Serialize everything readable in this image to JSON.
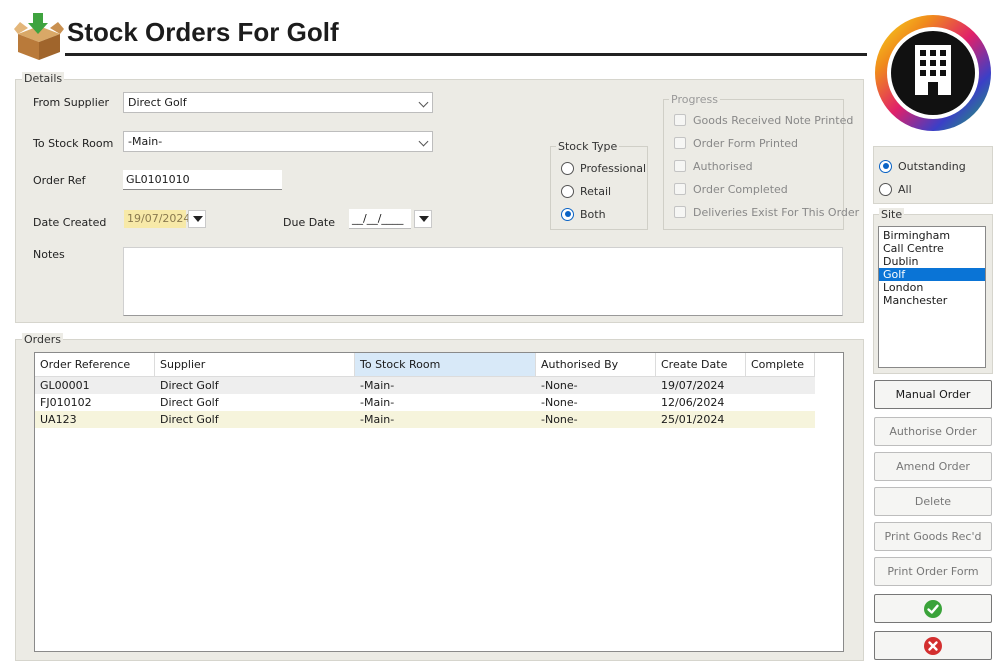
{
  "header": {
    "title": "Stock Orders For Golf",
    "logo_icon": "building-icon",
    "title_icon": "box-arrow-icon"
  },
  "details": {
    "legend": "Details",
    "from_supplier_label": "From Supplier",
    "from_supplier_value": "Direct Golf",
    "to_stock_room_label": "To Stock Room",
    "to_stock_room_value": "-Main-",
    "order_ref_label": "Order Ref",
    "order_ref_value": "GL0101010",
    "date_created_label": "Date Created",
    "date_created_value": "19/07/2024",
    "due_date_label": "Due Date",
    "due_date_value": "__/__/____",
    "notes_label": "Notes",
    "notes_value": ""
  },
  "stock_type": {
    "legend": "Stock Type",
    "options": [
      {
        "label": "Professional",
        "selected": false
      },
      {
        "label": "Retail",
        "selected": false
      },
      {
        "label": "Both",
        "selected": true
      }
    ]
  },
  "progress": {
    "legend": "Progress",
    "items": [
      {
        "label": "Goods Received Note Printed",
        "checked": false
      },
      {
        "label": "Order Form Printed",
        "checked": false
      },
      {
        "label": "Authorised",
        "checked": false
      },
      {
        "label": "Order Completed",
        "checked": false
      },
      {
        "label": "Deliveries Exist For This Order",
        "checked": false
      }
    ]
  },
  "orders": {
    "legend": "Orders",
    "columns": [
      "Order Reference",
      "Supplier",
      "To Stock Room",
      "Authorised By",
      "Create Date",
      "Complete"
    ],
    "rows": [
      [
        "GL00001",
        "Direct Golf",
        "-Main-",
        "-None-",
        "19/07/2024",
        ""
      ],
      [
        "FJ010102",
        "Direct Golf",
        "-Main-",
        "-None-",
        "12/06/2024",
        ""
      ],
      [
        "UA123",
        "Direct Golf",
        "-Main-",
        "-None-",
        "25/01/2024",
        ""
      ]
    ]
  },
  "filter": {
    "options": [
      {
        "label": "Outstanding",
        "selected": true
      },
      {
        "label": "All",
        "selected": false
      }
    ]
  },
  "site": {
    "legend": "Site",
    "items": [
      "Birmingham",
      "Call Centre",
      "Dublin",
      "Golf",
      "London",
      "Manchester"
    ],
    "selected": "Golf"
  },
  "buttons": {
    "manual_order": "Manual Order",
    "authorise_order": "Authorise Order",
    "amend_order": "Amend Order",
    "delete": "Delete",
    "print_goods_recd": "Print Goods Rec'd",
    "print_order_form": "Print Order Form",
    "ok_icon": "check-icon",
    "cancel_icon": "cross-icon"
  },
  "colors": {
    "accent": "#0a74d6",
    "panel": "#ecebe5",
    "ok": "#3aa33a",
    "cancel": "#d32f2f"
  }
}
